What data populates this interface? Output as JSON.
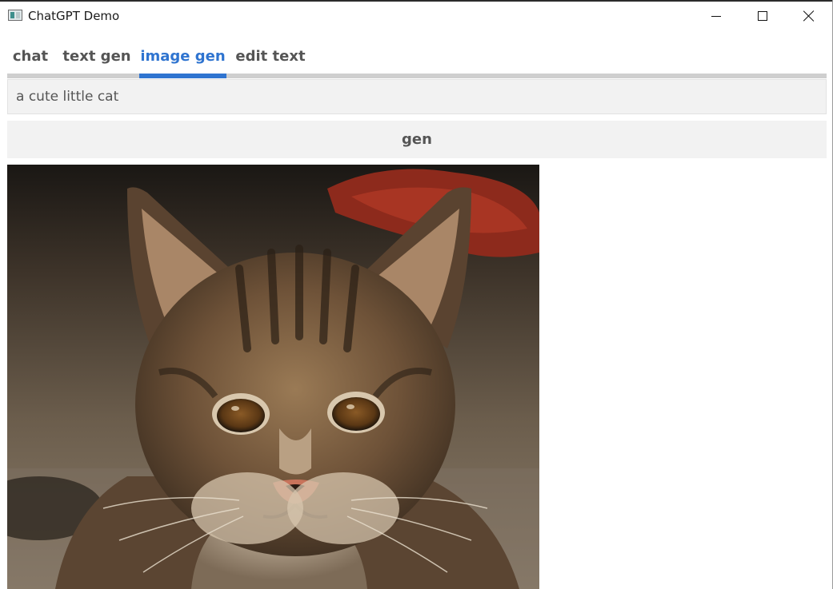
{
  "window": {
    "title": "ChatGPT Demo"
  },
  "tabs": [
    {
      "label": "chat"
    },
    {
      "label": "text gen"
    },
    {
      "label": "image gen",
      "active": true
    },
    {
      "label": "edit text"
    }
  ],
  "prompt": {
    "value": "a cute little cat"
  },
  "gen_button": {
    "label": "gen"
  },
  "colors": {
    "accent": "#2f74d0",
    "tab_track": "#cfcfcf",
    "input_bg": "#f2f2f2",
    "text": "#555555"
  },
  "icons": {
    "app": "app-window-icon",
    "minimize": "minimize-icon",
    "maximize": "maximize-icon",
    "close": "close-icon"
  }
}
